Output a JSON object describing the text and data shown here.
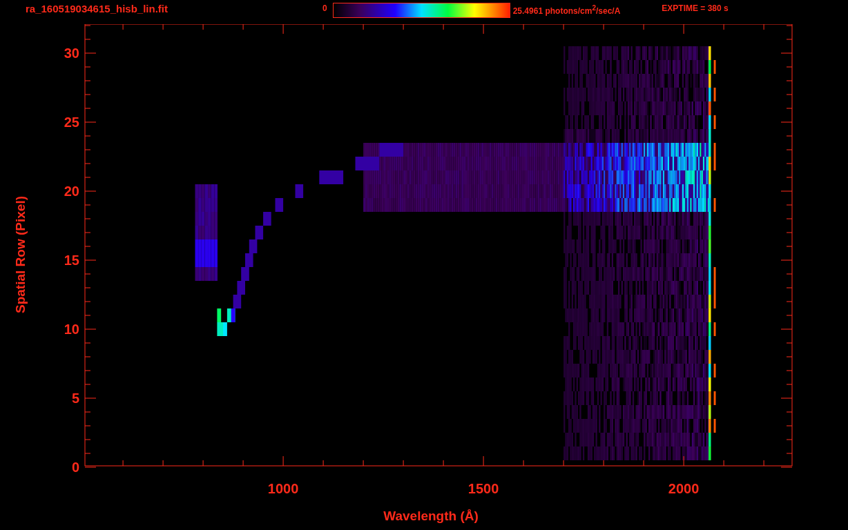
{
  "title": "ra_160519034615_hisb_lin.fit",
  "colorbar": {
    "min_label": "0",
    "max_label": "25.4961 photons/cm$^{2}$/sec/A"
  },
  "exposure": "EXPTIME = 380 s",
  "y_axis": {
    "label": "Spatial Row (Pixel)",
    "ticks": [
      "30",
      "25",
      "20",
      "15",
      "10",
      "5",
      "0"
    ]
  },
  "x_axis": {
    "label": "Wavelength (Å)",
    "ticks": [
      "1000",
      "1500",
      "2000"
    ]
  }
}
